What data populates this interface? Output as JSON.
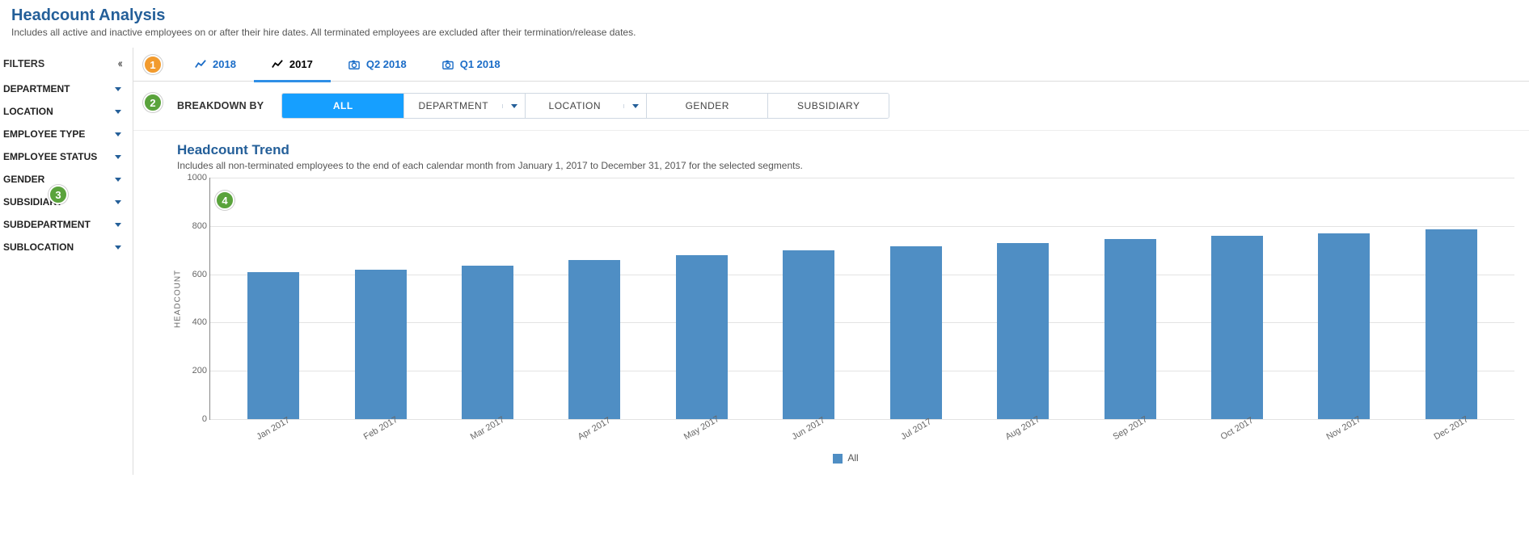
{
  "header": {
    "title": "Headcount Analysis",
    "subtitle": "Includes all active and inactive employees on or after their hire dates. All terminated employees are excluded after their termination/release dates."
  },
  "sidebar": {
    "filters_label": "FILTERS",
    "items": [
      {
        "label": "DEPARTMENT"
      },
      {
        "label": "LOCATION"
      },
      {
        "label": "EMPLOYEE TYPE"
      },
      {
        "label": "EMPLOYEE STATUS"
      },
      {
        "label": "GENDER"
      },
      {
        "label": "SUBSIDIARY"
      },
      {
        "label": "SUBDEPARTMENT"
      },
      {
        "label": "SUBLOCATION"
      }
    ]
  },
  "tabs": [
    {
      "label": "2018",
      "icon": "trend",
      "active": false
    },
    {
      "label": "2017",
      "icon": "trend",
      "active": true
    },
    {
      "label": "Q2 2018",
      "icon": "camera",
      "active": false
    },
    {
      "label": "Q1 2018",
      "icon": "camera",
      "active": false
    }
  ],
  "breakdown": {
    "label": "BREAKDOWN BY",
    "options": [
      {
        "label": "ALL",
        "selected": true,
        "dropdown": false
      },
      {
        "label": "DEPARTMENT",
        "selected": false,
        "dropdown": true
      },
      {
        "label": "LOCATION",
        "selected": false,
        "dropdown": true
      },
      {
        "label": "GENDER",
        "selected": false,
        "dropdown": false
      },
      {
        "label": "SUBSIDIARY",
        "selected": false,
        "dropdown": false
      }
    ]
  },
  "chart": {
    "title": "Headcount Trend",
    "subtitle": "Includes all non-terminated employees to the end of each calendar month from January 1, 2017 to December 31, 2017 for the selected segments.",
    "ylabel": "HEADCOUNT",
    "legend_label": "All"
  },
  "chart_data": {
    "type": "bar",
    "title": "Headcount Trend",
    "xlabel": "",
    "ylabel": "HEADCOUNT",
    "categories": [
      "Jan 2017",
      "Feb 2017",
      "Mar 2017",
      "Apr 2017",
      "May 2017",
      "Jun 2017",
      "Jul 2017",
      "Aug 2017",
      "Sep 2017",
      "Oct 2017",
      "Nov 2017",
      "Dec 2017"
    ],
    "series": [
      {
        "name": "All",
        "values": [
          610,
          620,
          635,
          660,
          680,
          700,
          715,
          730,
          745,
          760,
          770,
          785
        ]
      }
    ],
    "ylim": [
      0,
      1000
    ],
    "yticks": [
      0,
      200,
      400,
      600,
      800,
      1000
    ]
  },
  "callouts": {
    "c1": "1",
    "c2": "2",
    "c3": "3",
    "c4": "4"
  }
}
